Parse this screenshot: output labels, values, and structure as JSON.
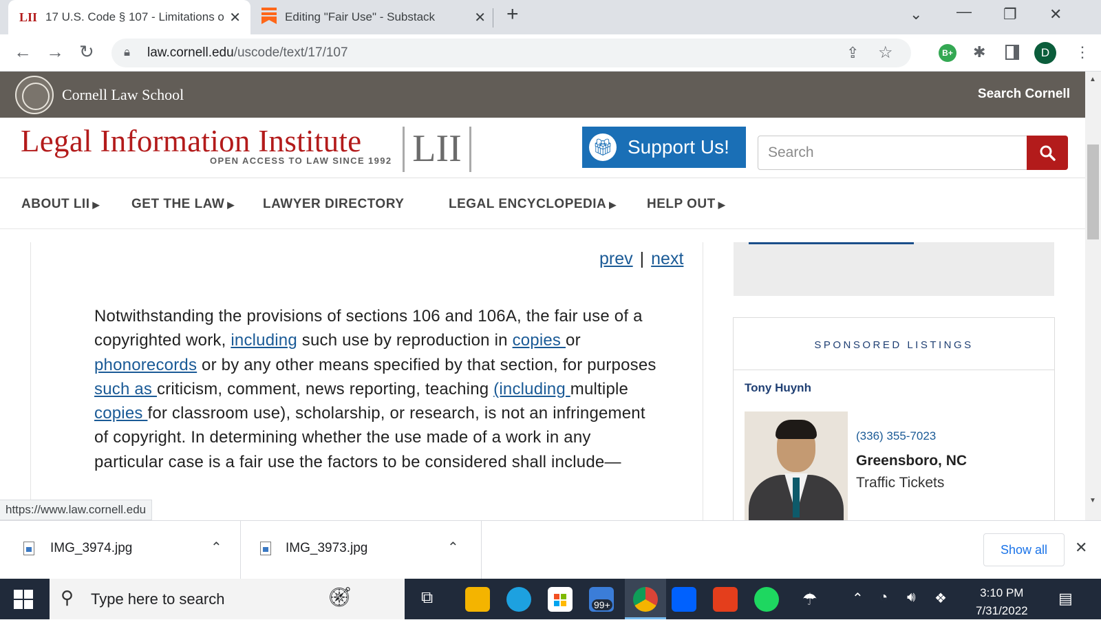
{
  "browser": {
    "tabs": [
      {
        "favicon": "LII",
        "title": "17 U.S. Code § 107 - Limitations o",
        "close": "✕"
      },
      {
        "favicon": "substack-icon",
        "title": "Editing \"Fair Use\" - Substack",
        "close": "✕"
      }
    ],
    "new_tab": "+",
    "url_domain": "law.cornell.edu",
    "url_path": "/uscode/text/17/107",
    "profile_initial": "D",
    "extension_badge": "B+"
  },
  "site": {
    "cornell_name": "Cornell Law School",
    "search_cornell": "Search Cornell",
    "lii_title": "Legal Information Institute",
    "lii_tagline": "OPEN ACCESS TO LAW SINCE 1992",
    "lii_logo": "LII",
    "support_label": "Support Us!",
    "search_placeholder": "Search",
    "nav": [
      {
        "label": "ABOUT LII",
        "caret": "▶"
      },
      {
        "label": "GET THE LAW",
        "caret": "▶"
      },
      {
        "label": "LAWYER DIRECTORY",
        "caret": ""
      },
      {
        "label": "LEGAL ENCYCLOPEDIA",
        "caret": "▶"
      },
      {
        "label": "HELP OUT",
        "caret": "▶"
      }
    ]
  },
  "content": {
    "prev": "prev",
    "sep": "|",
    "next": "next",
    "p": {
      "t1": "Notwithstanding the provisions of sections 106 and 106A, the fair use of a copyrighted work, ",
      "l1": "including",
      "t2": " such use by reproduction in ",
      "l2": "copies ",
      "t3": "or ",
      "l3": "phonorecords",
      "t4": " or by any other means specified by that section, for purposes",
      "l4": " such as ",
      "t5": "criticism, comment, news reporting, teaching ",
      "l5": "(including ",
      "t6": "multiple",
      "l6": " copies ",
      "t7": "for classroom use), scholarship, or research, is not an infringement of copyright. In determining whether the use made of a work in any particular case is a fair use the factors to be considered shall include—"
    }
  },
  "sidebar": {
    "sponsored_header": "SPONSORED LISTINGS",
    "lawyer": {
      "name": "Tony Huynh",
      "phone": "(336) 355-7023",
      "city": "Greensboro, NC",
      "practice": "Traffic Tickets"
    }
  },
  "status_url": "https://www.law.cornell.edu",
  "downloads": {
    "items": [
      {
        "name": "IMG_3974.jpg"
      },
      {
        "name": "IMG_3973.jpg"
      }
    ],
    "show_all": "Show all"
  },
  "taskbar": {
    "search_placeholder": "Type here to search",
    "mail_badge": "99+",
    "time": "3:10 PM",
    "date": "7/31/2022"
  },
  "colors": {
    "lii_red": "#b31b1b",
    "support_blue": "#1a6fb6",
    "cornell_bar": "#625d57",
    "link": "#1a5a96"
  }
}
